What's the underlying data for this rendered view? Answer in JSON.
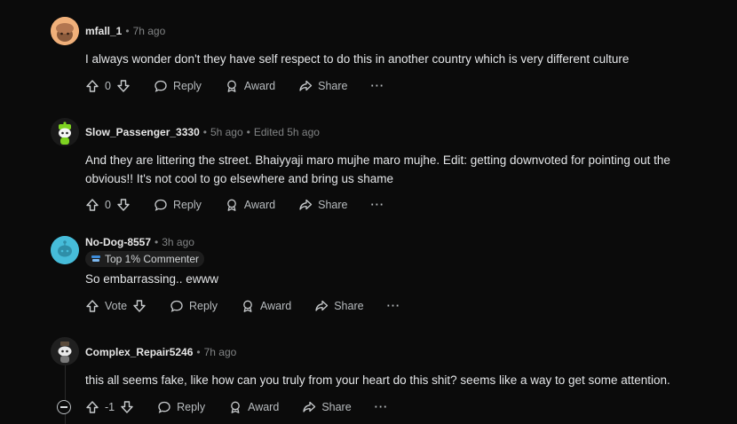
{
  "comments": [
    {
      "username": "mfall_1",
      "time": "7h ago",
      "edited": "",
      "text": "I always wonder don't they have self respect to do this in another country which is very different culture",
      "votes": "0",
      "reply": "Reply",
      "award": "Award",
      "share": "Share",
      "more": "···"
    },
    {
      "username": "Slow_Passenger_3330",
      "time": "5h ago",
      "edited": "Edited 5h ago",
      "text": "And they are littering the street. Bhaiyyaji maro mujhe maro mujhe. Edit: getting downvoted for pointing out the obvious!! It's not cool to go elsewhere and bring us shame",
      "votes": "0",
      "reply": "Reply",
      "award": "Award",
      "share": "Share",
      "more": "···"
    },
    {
      "username": "No-Dog-8557",
      "time": "3h ago",
      "badge": "Top 1% Commenter",
      "text": "So embarrassing.. ewww",
      "votes": "Vote",
      "reply": "Reply",
      "award": "Award",
      "share": "Share",
      "more": "···"
    },
    {
      "username": "Complex_Repair5246",
      "time": "7h ago",
      "text": "this all seems fake, like how can you truly from your heart do this shit? seems like a way to get some attention.",
      "votes": "-1",
      "reply": "Reply",
      "award": "Award",
      "share": "Share",
      "more": "···"
    }
  ],
  "colors": {
    "background": "#0b0b0b",
    "text": "#e4e6e8",
    "muted": "#818384",
    "badge_bg": "#1e1e1e"
  }
}
